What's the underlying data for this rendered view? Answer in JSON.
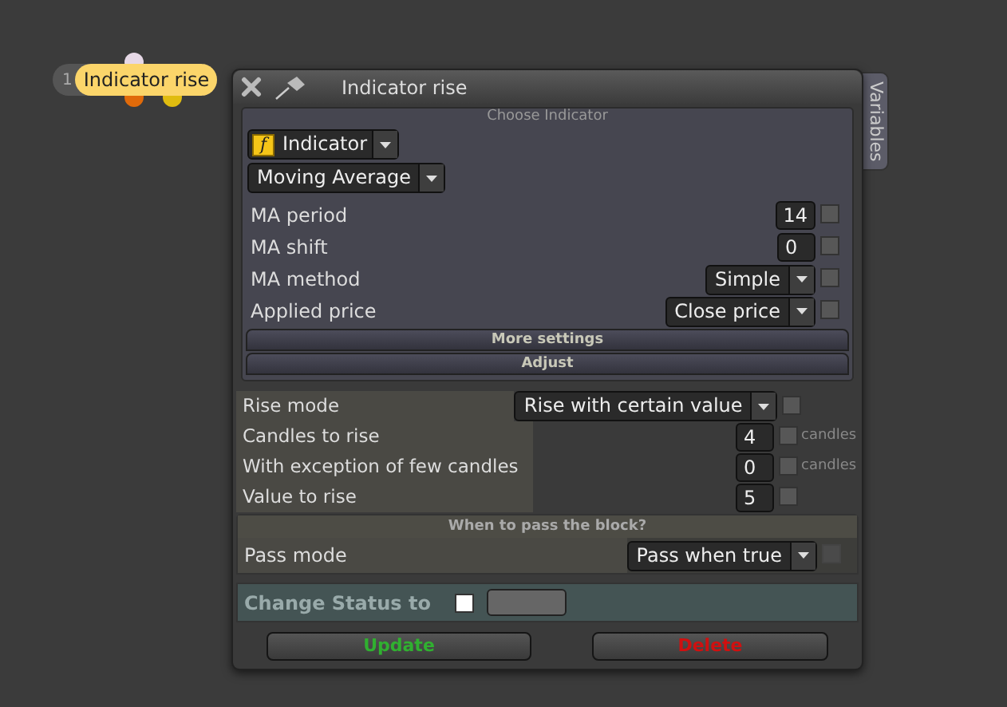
{
  "node": {
    "number": "1",
    "title": "Indicator rise"
  },
  "window": {
    "title": "Indicator rise",
    "side_tab": "Variables"
  },
  "indicator_panel": {
    "legend": "Choose Indicator",
    "type_icon": "f",
    "type_value": "Indicator",
    "indicator_value": "Moving Average",
    "params": [
      {
        "label": "MA period",
        "kind": "number",
        "value": "14",
        "checked": false
      },
      {
        "label": "MA shift",
        "kind": "number",
        "value": "0",
        "checked": false
      },
      {
        "label": "MA method",
        "kind": "select",
        "value": "Simple",
        "checked": false
      },
      {
        "label": "Applied price",
        "kind": "select",
        "value": "Close price",
        "checked": false
      }
    ],
    "buttons": [
      "More settings",
      "Adjust"
    ]
  },
  "rise_settings": [
    {
      "label": "Rise mode",
      "kind": "select",
      "value": "Rise with certain value",
      "checked": false
    },
    {
      "label": "Candles to rise",
      "kind": "number",
      "value": "4",
      "unit": "candles",
      "checked": false
    },
    {
      "label": "With exception of few candles",
      "kind": "number",
      "value": "0",
      "unit": "candles",
      "checked": false
    },
    {
      "label": "Value to rise",
      "kind": "number",
      "value": "5",
      "checked": false
    }
  ],
  "pass_section": {
    "heading": "When to pass the block?",
    "label": "Pass mode",
    "value": "Pass when true",
    "checked": false,
    "disabled": true
  },
  "status": {
    "label": "Change Status to",
    "checked": false
  },
  "buttons": [
    {
      "label": "Update",
      "kind": "update"
    },
    {
      "label": "Delete",
      "kind": "delete"
    }
  ]
}
